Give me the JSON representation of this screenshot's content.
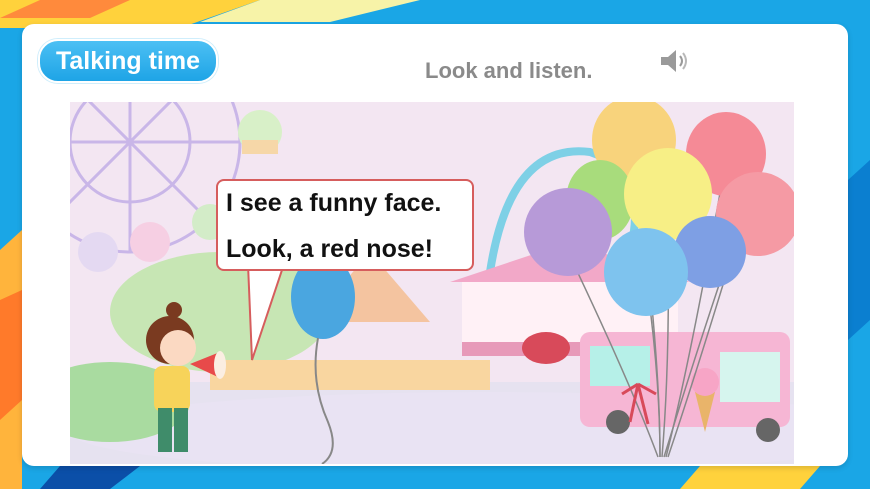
{
  "header": {
    "badge_label": "Talking time",
    "instruction": "Look and listen."
  },
  "audio": {
    "icon": "speaker-icon"
  },
  "scene": {
    "description_icon": "amusement-park-illustration",
    "speech_bubble": {
      "line1": "I see a funny face.",
      "line2": "Look, a red nose!"
    }
  },
  "colors": {
    "badge": "#1ea4e6",
    "background": "#1aa6e6",
    "bubble_border": "#d65d5d",
    "instruction_text": "#8a8a8a"
  }
}
